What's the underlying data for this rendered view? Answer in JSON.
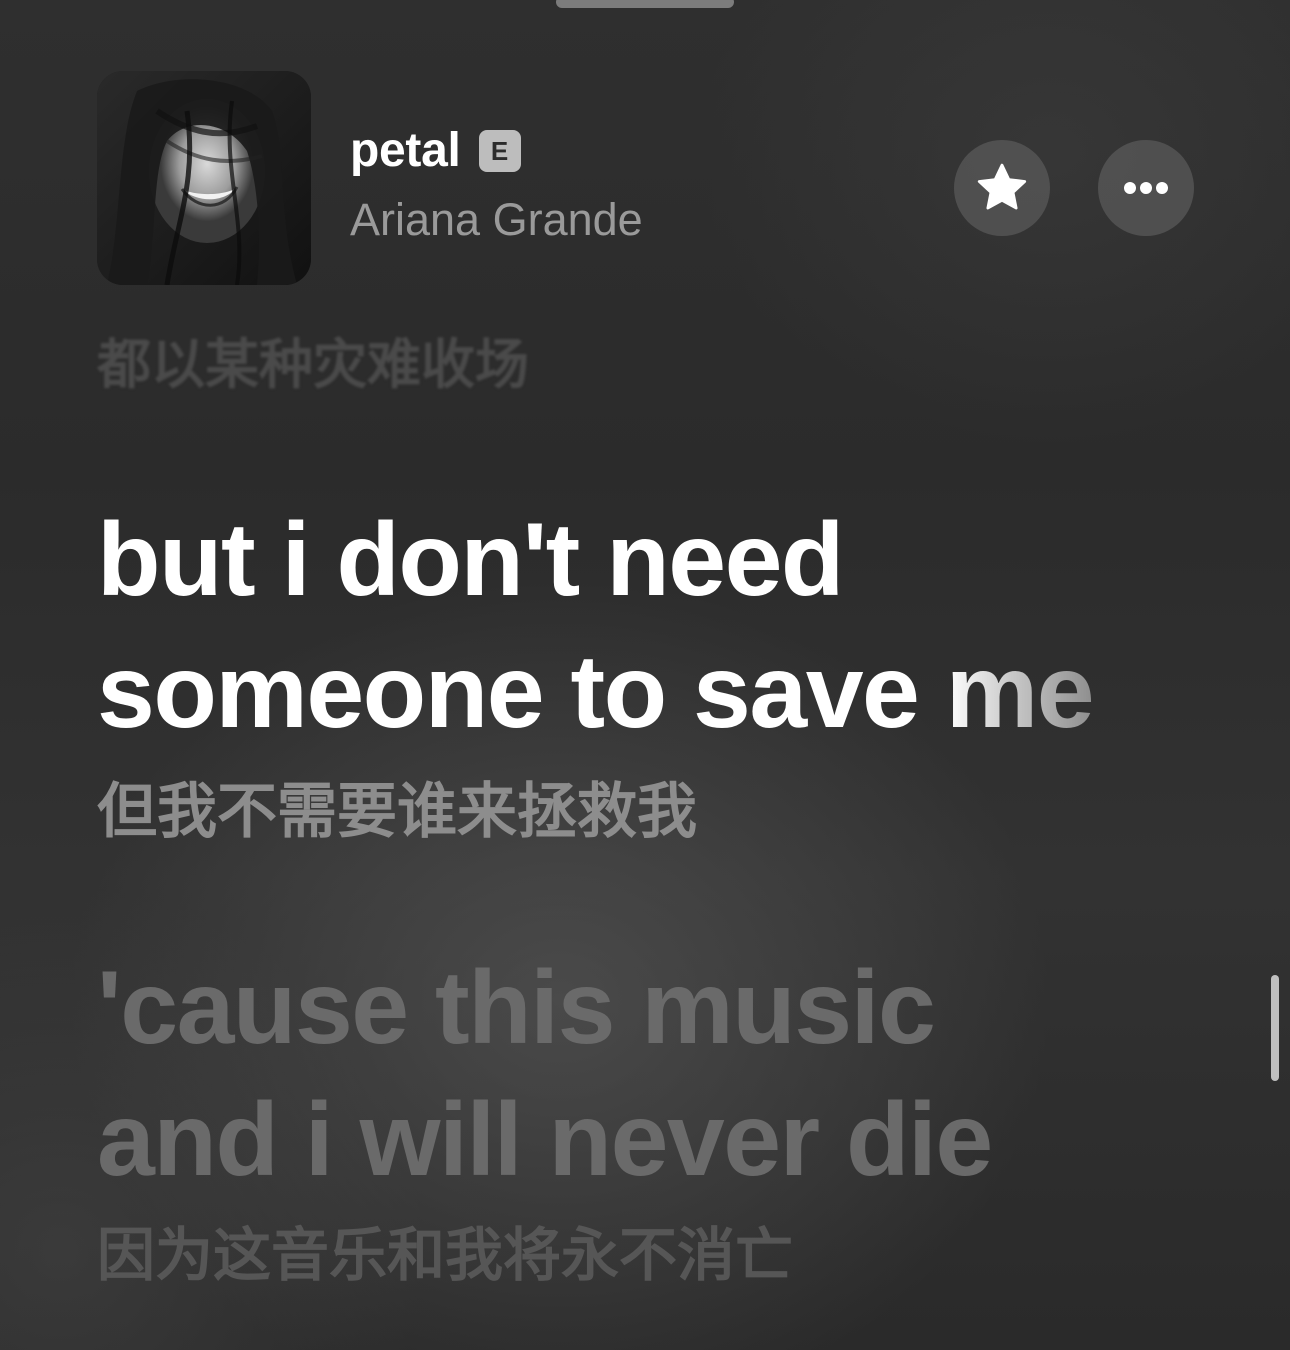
{
  "now_playing": {
    "title": "petal",
    "explicit_badge": "E",
    "artist": "Ariana Grande"
  },
  "actions": {
    "favorite_icon": "star-icon",
    "more_icon": "ellipsis-icon"
  },
  "lyrics": {
    "previous_translation": "都以某种灾难收场",
    "active": {
      "line1": "but i don't need",
      "line2_sung": "someone to save ",
      "line2_fading": "me"
    },
    "active_translation": "但我不需要谁来拯救我",
    "next": {
      "line1": "'cause this music",
      "line2": "and i will never die"
    },
    "next_translation": "因为这音乐和我将永不消亡"
  }
}
